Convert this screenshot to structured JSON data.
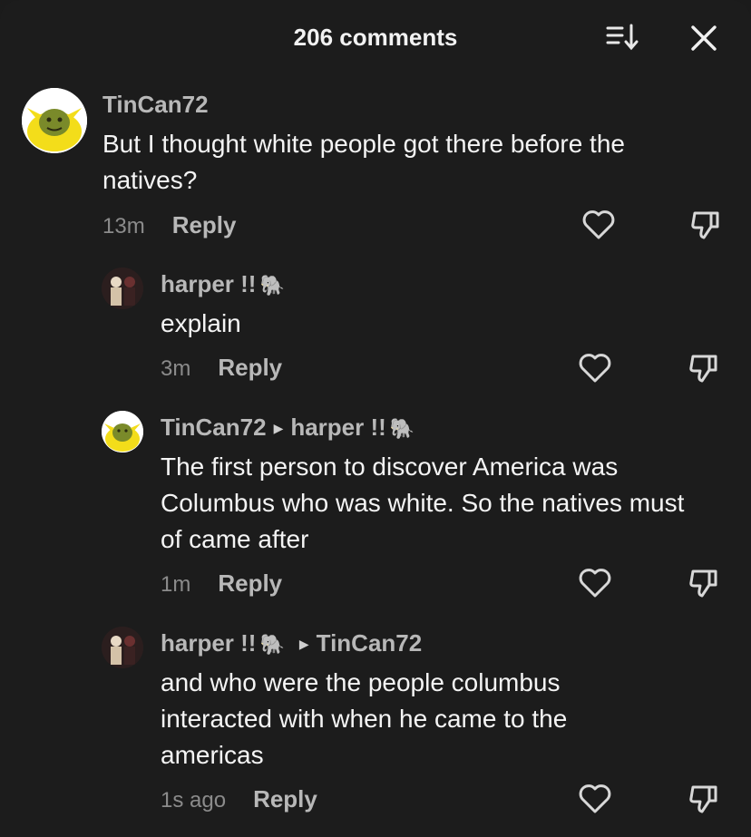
{
  "header": {
    "title": "206 comments",
    "sort_icon": "sort-descending-icon",
    "close_icon": "close-icon"
  },
  "comments": [
    {
      "username": "TinCan72",
      "text": "But I thought white people got there before the natives?",
      "time": "13m",
      "reply_label": "Reply",
      "avatar": "shrek-pikachu-avatar"
    },
    {
      "username": "harper !!",
      "emoji": "🐘",
      "text": "explain",
      "time": "3m",
      "reply_label": "Reply",
      "avatar": "harper-avatar"
    },
    {
      "username": "TinCan72",
      "reply_to": "harper !!",
      "reply_to_emoji": "🐘",
      "text": "The first person to discover America was Columbus who was white. So the natives must of came after",
      "time": "1m",
      "reply_label": "Reply",
      "avatar": "shrek-pikachu-avatar"
    },
    {
      "username": "harper !!",
      "emoji": "🐘",
      "reply_to": "TinCan72",
      "text": "and who were the people columbus interacted with when he came to the americas",
      "time": "1s ago",
      "reply_label": "Reply",
      "avatar": "harper-avatar"
    }
  ],
  "colors": {
    "background": "#1c1c1c",
    "username": "#b8b8b8",
    "text": "#f4f4f4",
    "meta": "#8b8b8b"
  }
}
